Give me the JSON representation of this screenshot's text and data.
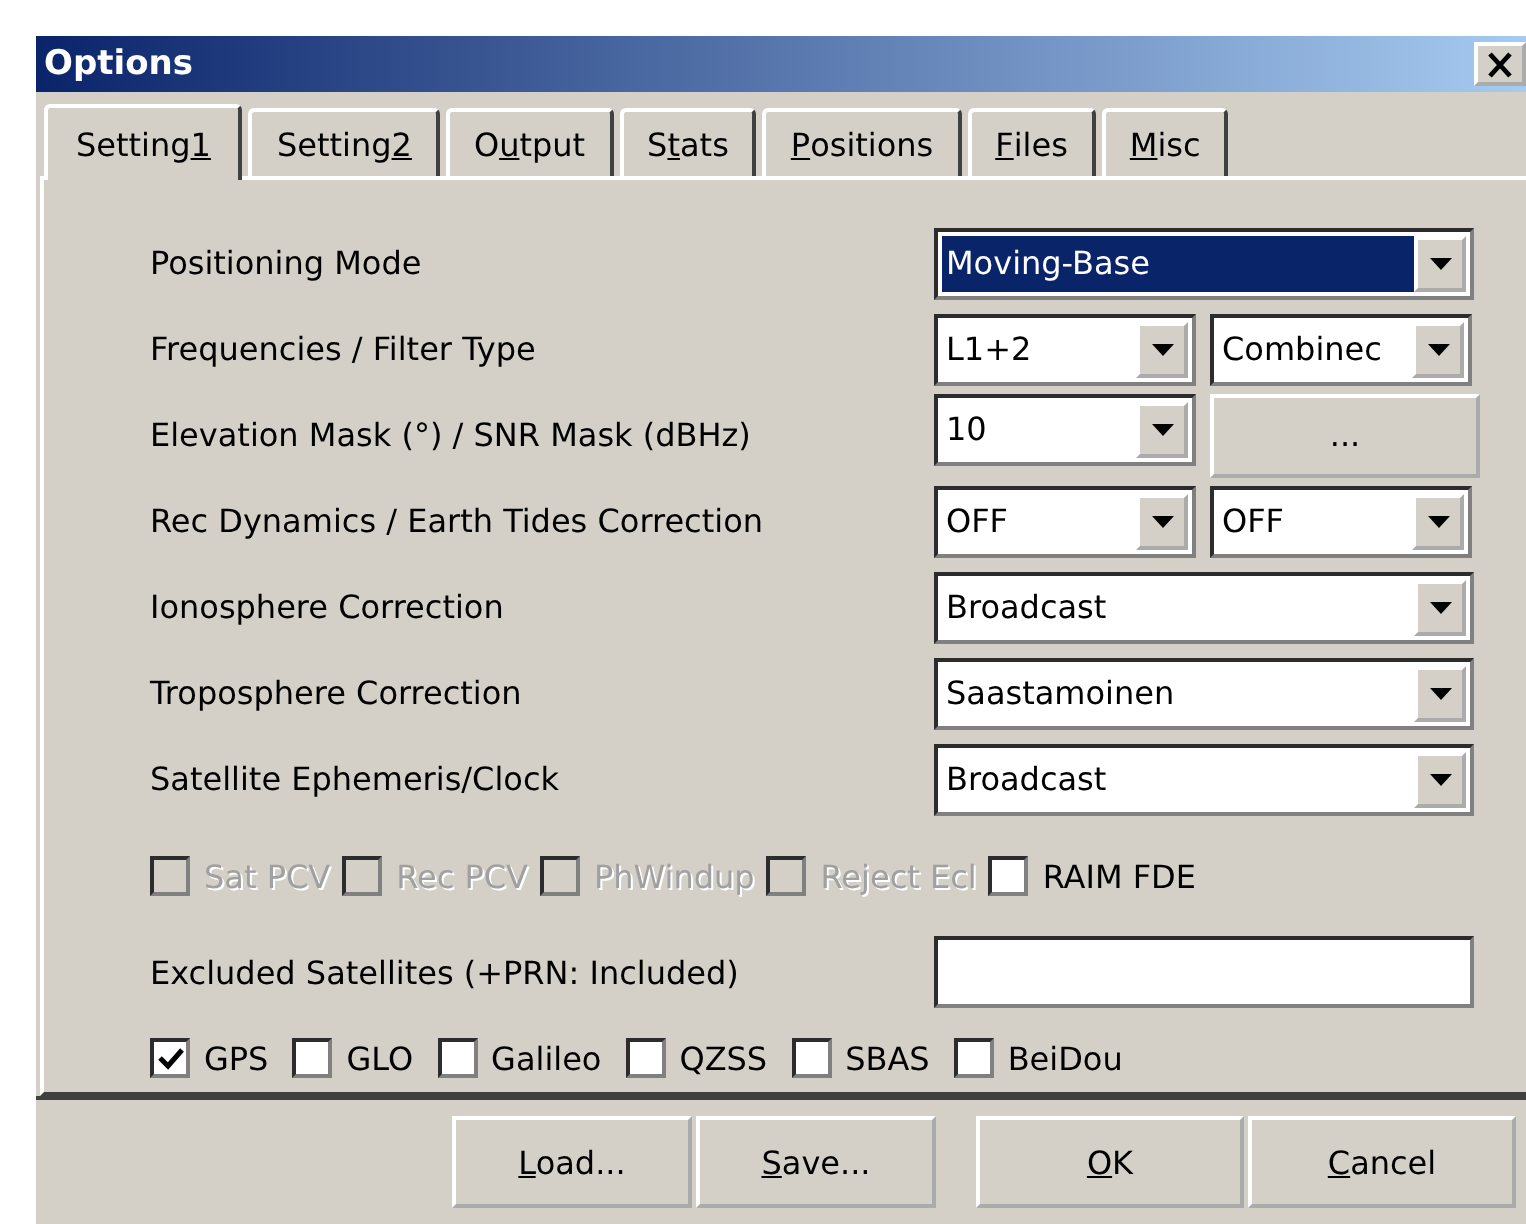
{
  "window": {
    "title": "Options"
  },
  "tabs": [
    {
      "pre": "Setting",
      "key": "1",
      "selected": true
    },
    {
      "pre": "Setting",
      "key": "2",
      "selected": false
    },
    {
      "pre": "O",
      "key": "u",
      "post": "tput",
      "selected": false
    },
    {
      "pre": "S",
      "key": "t",
      "post": "ats",
      "selected": false
    },
    {
      "key": "P",
      "post": "ositions",
      "selected": false
    },
    {
      "key": "F",
      "post": "iles",
      "selected": false
    },
    {
      "key": "M",
      "post": "isc",
      "selected": false
    }
  ],
  "rows": [
    {
      "label": "Positioning Mode",
      "controls": [
        {
          "kind": "select",
          "value": "Moving-Base",
          "focused": true
        }
      ]
    },
    {
      "label": "Frequencies / Filter Type",
      "controls": [
        {
          "kind": "select",
          "value": "L1+2",
          "focused": false
        },
        {
          "kind": "select",
          "value": "Combinec",
          "focused": false
        }
      ]
    },
    {
      "label": "Elevation Mask (°) / SNR Mask (dBHz)",
      "controls": [
        {
          "kind": "select",
          "value": "10",
          "focused": false
        },
        {
          "kind": "button",
          "value": "..."
        }
      ]
    },
    {
      "label": "Rec Dynamics / Earth Tides Correction",
      "controls": [
        {
          "kind": "select",
          "value": "OFF",
          "focused": false
        },
        {
          "kind": "select",
          "value": "OFF",
          "focused": false
        }
      ]
    },
    {
      "label": "Ionosphere Correction",
      "controls": [
        {
          "kind": "select",
          "value": "Broadcast",
          "focused": false
        }
      ]
    },
    {
      "label": "Troposphere Correction",
      "controls": [
        {
          "kind": "select",
          "value": "Saastamoinen",
          "focused": false
        }
      ]
    },
    {
      "label": "Satellite Ephemeris/Clock",
      "controls": [
        {
          "kind": "select",
          "value": "Broadcast",
          "focused": false
        }
      ]
    }
  ],
  "options": [
    {
      "label": "Sat PCV",
      "checked": false,
      "disabled": true
    },
    {
      "label": "Rec PCV",
      "checked": false,
      "disabled": true
    },
    {
      "label": "PhWindup",
      "checked": false,
      "disabled": true
    },
    {
      "label": "Reject Ecl",
      "checked": false,
      "disabled": true
    },
    {
      "label": "RAIM FDE",
      "checked": false,
      "disabled": false
    }
  ],
  "excluded": {
    "label": "Excluded Satellites (+PRN: Included)"
  },
  "systems": [
    {
      "label": "GPS",
      "checked": true
    },
    {
      "label": "GLO",
      "checked": false
    },
    {
      "label": "Galileo",
      "checked": false
    },
    {
      "label": "QZSS",
      "checked": false
    },
    {
      "label": "SBAS",
      "checked": false
    },
    {
      "label": "BeiDou",
      "checked": false
    }
  ],
  "buttons": [
    [
      {
        "key": "L",
        "post": "oad..."
      },
      {
        "key": "S",
        "post": "ave..."
      }
    ],
    [
      {
        "key": "O",
        "post": "K"
      },
      {
        "key": "C",
        "post": "ancel"
      }
    ]
  ]
}
